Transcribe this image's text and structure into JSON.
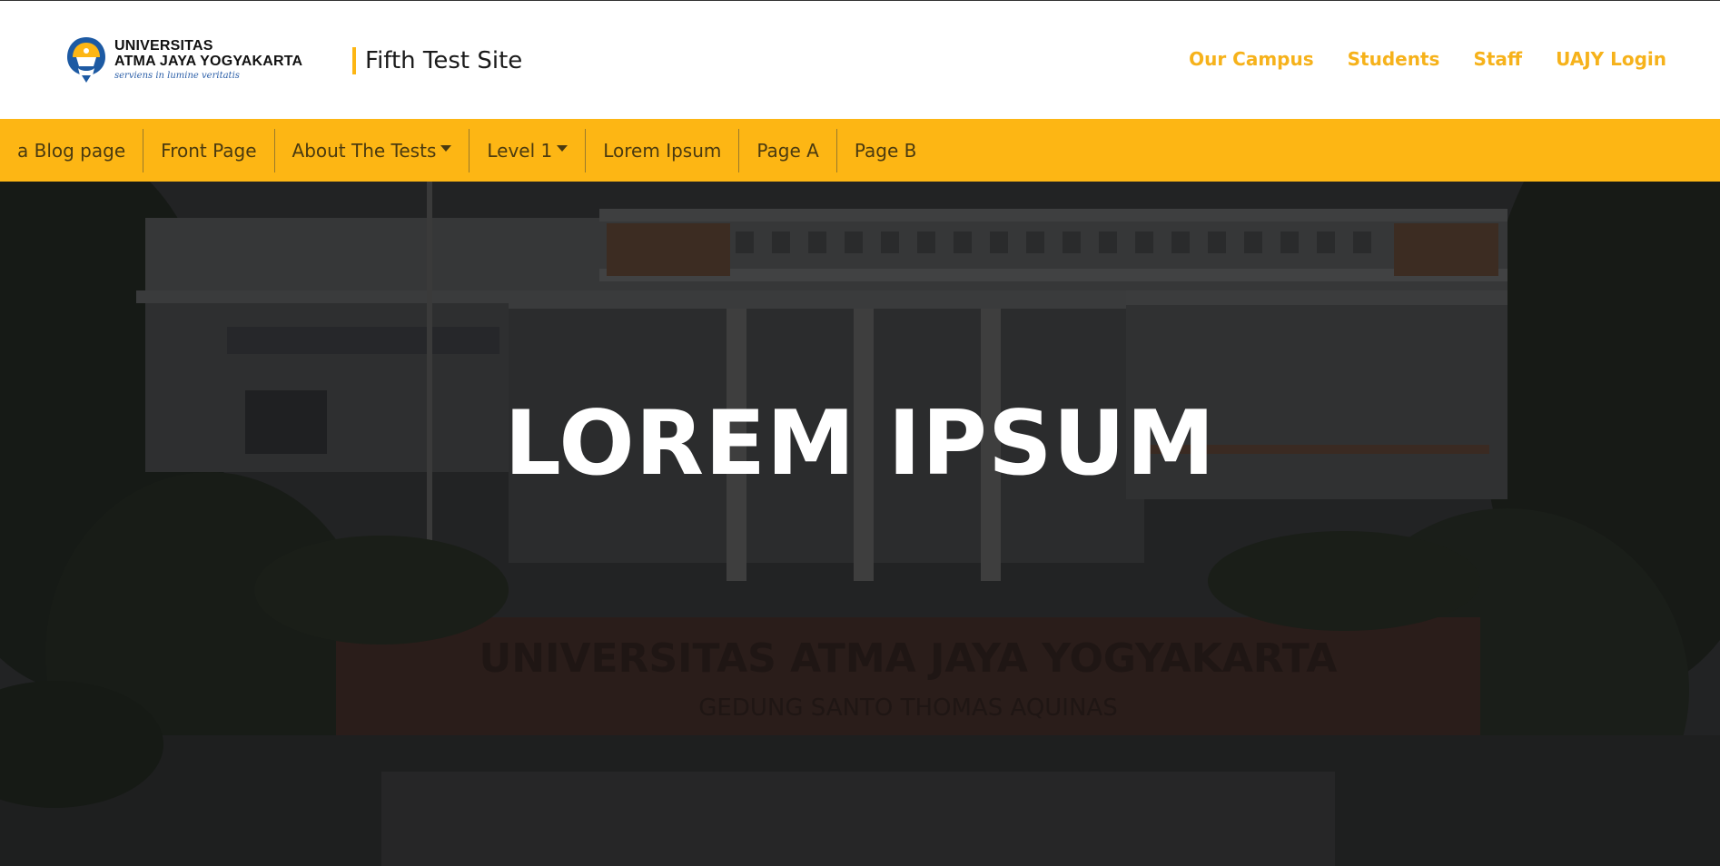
{
  "header": {
    "logo": {
      "line1": "UNIVERSITAS",
      "line2": "ATMA JAYA YOGYAKARTA",
      "tagline": "serviens in lumine veritatis",
      "icon": "university-emblem"
    },
    "site_title": "Fifth Test Site",
    "links": [
      {
        "label": "Our Campus"
      },
      {
        "label": "Students"
      },
      {
        "label": "Staff"
      },
      {
        "label": "UAJY Login"
      }
    ]
  },
  "nav": {
    "items": [
      {
        "label": "a Blog page"
      },
      {
        "label": "Front Page"
      },
      {
        "label": "About The Tests",
        "dropdown": true
      },
      {
        "label": "Level 1",
        "dropdown": true
      },
      {
        "label": "Lorem Ipsum"
      },
      {
        "label": "Page A"
      },
      {
        "label": "Page B"
      }
    ]
  },
  "hero": {
    "title": "LOREM IPSUM",
    "background_sign_line1": "UNIVERSITAS ATMA JAYA YOGYAKARTA",
    "background_sign_line2": "GEDUNG SANTO THOMAS AQUINAS"
  },
  "colors": {
    "accent": "#fdb614",
    "link": "#f6b21b",
    "nav_text": "#4a3a10",
    "hero_overlay": "#1e1f20"
  }
}
